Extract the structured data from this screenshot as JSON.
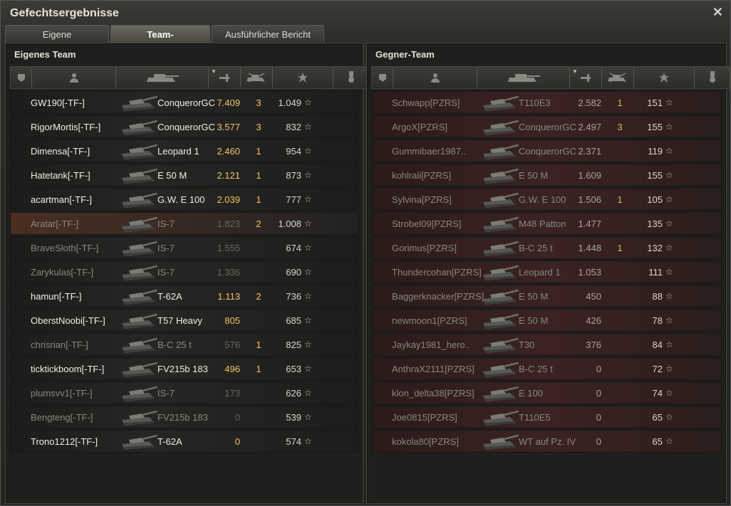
{
  "window": {
    "title": "Gefechtsergebnisse",
    "close": "✕"
  },
  "tabs": [
    {
      "label": "Eigene Auswertung"
    },
    {
      "label": "Team-Auswertung"
    },
    {
      "label": "Ausführlicher Bericht"
    }
  ],
  "left": {
    "title": "Eigenes Team",
    "rows": [
      {
        "name": "GW190[-TF-]",
        "tank": "ConquerorGC",
        "dmg": "7.409",
        "kills": "3",
        "xp": "1.049",
        "s": "bright"
      },
      {
        "name": "RigorMortis[-TF-]",
        "tank": "ConquerorGC",
        "dmg": "3.577",
        "kills": "3",
        "xp": "832",
        "s": "bright"
      },
      {
        "name": "Dimensa[-TF-]",
        "tank": "Leopard 1",
        "dmg": "2.460",
        "kills": "1",
        "xp": "954",
        "s": "bright"
      },
      {
        "name": "Hatetank[-TF-]",
        "tank": "E 50 M",
        "dmg": "2.121",
        "kills": "1",
        "xp": "873",
        "s": "bright"
      },
      {
        "name": "acartman[-TF-]",
        "tank": "G.W. E 100",
        "dmg": "2.039",
        "kills": "1",
        "xp": "777",
        "s": "bright"
      },
      {
        "name": "Aratar[-TF-]",
        "tank": "IS-7",
        "dmg": "1.823",
        "kills": "2",
        "xp": "1.008",
        "s": "dim hl"
      },
      {
        "name": "BraveSloth[-TF-]",
        "tank": "IS-7",
        "dmg": "1.555",
        "kills": "",
        "xp": "674",
        "s": "dim"
      },
      {
        "name": "Zarykulas[-TF-]",
        "tank": "IS-7",
        "dmg": "1.336",
        "kills": "",
        "xp": "690",
        "s": "dim"
      },
      {
        "name": "hamun[-TF-]",
        "tank": "T-62A",
        "dmg": "1.113",
        "kills": "2",
        "xp": "736",
        "s": "bright"
      },
      {
        "name": "OberstNoobi[-TF-]",
        "tank": "T57 Heavy",
        "dmg": "805",
        "kills": "",
        "xp": "685",
        "s": "bright"
      },
      {
        "name": "chrisrian[-TF-]",
        "tank": "B-C 25 t",
        "dmg": "576",
        "kills": "1",
        "xp": "825",
        "s": "dim"
      },
      {
        "name": "ticktickboom[-TF-]",
        "tank": "FV215b 183",
        "dmg": "496",
        "kills": "1",
        "xp": "653",
        "s": "bright"
      },
      {
        "name": "plumsvv1[-TF-]",
        "tank": "IS-7",
        "dmg": "173",
        "kills": "",
        "xp": "626",
        "s": "dim"
      },
      {
        "name": "Bengteng[-TF-]",
        "tank": "FV215b 183",
        "dmg": "0",
        "kills": "",
        "xp": "539",
        "s": "dim"
      },
      {
        "name": "Trono1212[-TF-]",
        "tank": "T-62A",
        "dmg": "0",
        "kills": "",
        "xp": "574",
        "s": "bright"
      }
    ]
  },
  "right": {
    "title": "Gegner-Team",
    "rows": [
      {
        "name": "Schwapp[PZRS]",
        "tank": "T110E3",
        "dmg": "2.582",
        "kills": "1",
        "xp": "151",
        "s": "dim"
      },
      {
        "name": "ArgoX[PZRS]",
        "tank": "ConquerorGC",
        "dmg": "2.497",
        "kills": "3",
        "xp": "155",
        "s": "dim"
      },
      {
        "name": "Gummibaer1987..",
        "tank": "ConquerorGC",
        "dmg": "2.371",
        "kills": "",
        "xp": "119",
        "s": "dim"
      },
      {
        "name": "kohlrali[PZRS]",
        "tank": "E 50 M",
        "dmg": "1.609",
        "kills": "",
        "xp": "155",
        "s": "dim"
      },
      {
        "name": "Sylvina[PZRS]",
        "tank": "G.W. E 100",
        "dmg": "1.506",
        "kills": "1",
        "xp": "105",
        "s": "dim"
      },
      {
        "name": "Strobel09[PZRS]",
        "tank": "M48 Patton",
        "dmg": "1.477",
        "kills": "",
        "xp": "135",
        "s": "dim"
      },
      {
        "name": "Gorimus[PZRS]",
        "tank": "B-C 25 t",
        "dmg": "1.448",
        "kills": "1",
        "xp": "132",
        "s": "dim"
      },
      {
        "name": "Thundercohan[PZRS]",
        "tank": "Leopard 1",
        "dmg": "1.053",
        "kills": "",
        "xp": "111",
        "s": "dim"
      },
      {
        "name": "Baggerknacker[PZRS]",
        "tank": "E 50 M",
        "dmg": "450",
        "kills": "",
        "xp": "88",
        "s": "dim"
      },
      {
        "name": "newmoon1[PZRS]",
        "tank": "E 50 M",
        "dmg": "426",
        "kills": "",
        "xp": "78",
        "s": "dim"
      },
      {
        "name": "Jaykay1981_hero..",
        "tank": "T30",
        "dmg": "376",
        "kills": "",
        "xp": "84",
        "s": "dim"
      },
      {
        "name": "AnthraX2111[PZRS]",
        "tank": "B-C 25 t",
        "dmg": "0",
        "kills": "",
        "xp": "72",
        "s": "dim"
      },
      {
        "name": "klon_delta38[PZRS]",
        "tank": "E 100",
        "dmg": "0",
        "kills": "",
        "xp": "74",
        "s": "dim"
      },
      {
        "name": "Joe0815[PZRS]",
        "tank": "T110E5",
        "dmg": "0",
        "kills": "",
        "xp": "65",
        "s": "dim"
      },
      {
        "name": "kokola80[PZRS]",
        "tank": "WT auf Pz. IV",
        "dmg": "0",
        "kills": "",
        "xp": "65",
        "s": "dim"
      }
    ]
  },
  "star": "☆"
}
